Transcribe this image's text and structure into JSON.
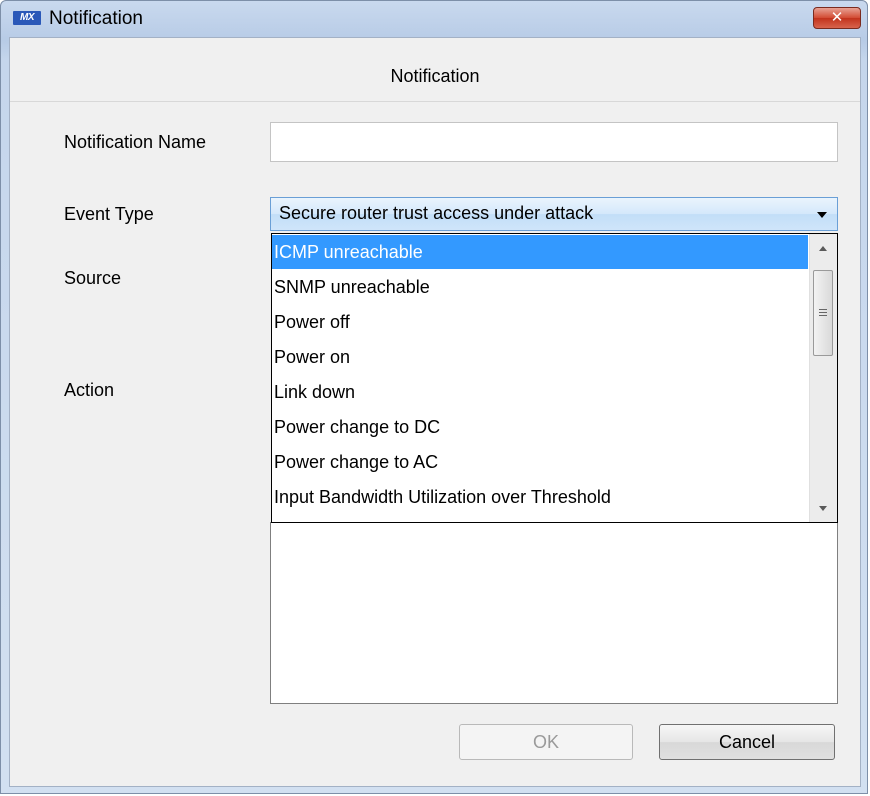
{
  "window": {
    "logo_text": "MX",
    "title": "Notification",
    "close_glyph": "✕"
  },
  "header": {
    "title": "Notification"
  },
  "form": {
    "notification_name_label": "Notification Name",
    "notification_name_value": "",
    "event_type_label": "Event Type",
    "event_type_value": "Secure router trust access under attack",
    "source_label": "Source",
    "action_label": "Action"
  },
  "event_type_options": [
    "ICMP unreachable",
    "SNMP unreachable",
    "Power off",
    "Power on",
    "Link down",
    "Power change to DC",
    "Power change to AC",
    "Input Bandwidth Utilization over Threshold"
  ],
  "highlighted_option_index": 0,
  "buttons": {
    "ok_label": "OK",
    "cancel_label": "Cancel"
  },
  "colors": {
    "selection": "#3399ff",
    "disabled_text": "#9a9a9a"
  }
}
